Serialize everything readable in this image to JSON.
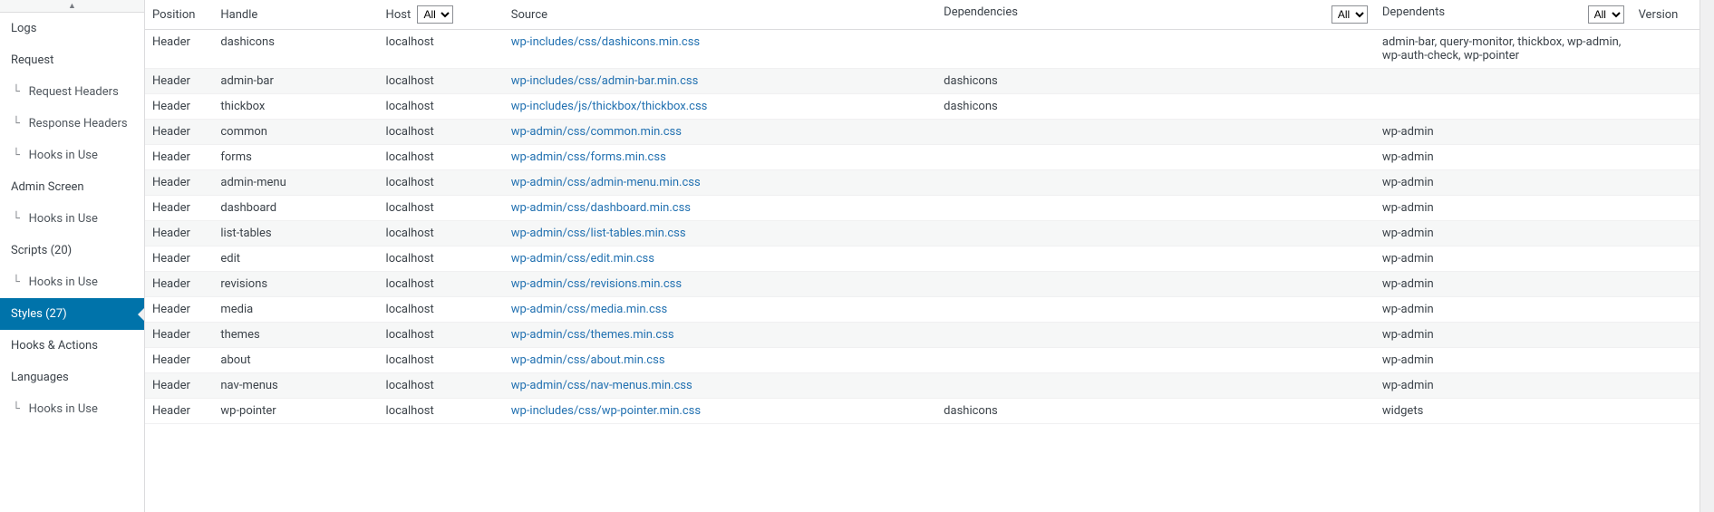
{
  "sidebar": {
    "items": [
      {
        "label": "Logs",
        "sub": false,
        "active": false
      },
      {
        "label": "Request",
        "sub": false,
        "active": false
      },
      {
        "label": "Request Headers",
        "sub": true,
        "active": false
      },
      {
        "label": "Response Headers",
        "sub": true,
        "active": false
      },
      {
        "label": "Hooks in Use",
        "sub": true,
        "active": false
      },
      {
        "label": "Admin Screen",
        "sub": false,
        "active": false
      },
      {
        "label": "Hooks in Use",
        "sub": true,
        "active": false
      },
      {
        "label": "Scripts (20)",
        "sub": false,
        "active": false
      },
      {
        "label": "Hooks in Use",
        "sub": true,
        "active": false
      },
      {
        "label": "Styles (27)",
        "sub": false,
        "active": true
      },
      {
        "label": "Hooks & Actions",
        "sub": false,
        "active": false
      },
      {
        "label": "Languages",
        "sub": false,
        "active": false
      },
      {
        "label": "Hooks in Use",
        "sub": true,
        "active": false
      }
    ]
  },
  "table": {
    "headers": {
      "position": "Position",
      "handle": "Handle",
      "host": "Host",
      "source": "Source",
      "dependencies": "Dependencies",
      "dependents": "Dependents",
      "version": "Version"
    },
    "filters": {
      "host": "All",
      "dependencies": "All",
      "dependents": "All"
    },
    "rows": [
      {
        "position": "Header",
        "handle": "dashicons",
        "host": "localhost",
        "source": "wp-includes/css/dashicons.min.css",
        "dependencies": "",
        "dependents": "admin-bar, query-monitor, thickbox, wp-admin, wp-auth-check, wp-pointer",
        "version": ""
      },
      {
        "position": "Header",
        "handle": "admin-bar",
        "host": "localhost",
        "source": "wp-includes/css/admin-bar.min.css",
        "dependencies": "dashicons",
        "dependents": "",
        "version": ""
      },
      {
        "position": "Header",
        "handle": "thickbox",
        "host": "localhost",
        "source": "wp-includes/js/thickbox/thickbox.css",
        "dependencies": "dashicons",
        "dependents": "",
        "version": ""
      },
      {
        "position": "Header",
        "handle": "common",
        "host": "localhost",
        "source": "wp-admin/css/common.min.css",
        "dependencies": "",
        "dependents": "wp-admin",
        "version": ""
      },
      {
        "position": "Header",
        "handle": "forms",
        "host": "localhost",
        "source": "wp-admin/css/forms.min.css",
        "dependencies": "",
        "dependents": "wp-admin",
        "version": ""
      },
      {
        "position": "Header",
        "handle": "admin-menu",
        "host": "localhost",
        "source": "wp-admin/css/admin-menu.min.css",
        "dependencies": "",
        "dependents": "wp-admin",
        "version": ""
      },
      {
        "position": "Header",
        "handle": "dashboard",
        "host": "localhost",
        "source": "wp-admin/css/dashboard.min.css",
        "dependencies": "",
        "dependents": "wp-admin",
        "version": ""
      },
      {
        "position": "Header",
        "handle": "list-tables",
        "host": "localhost",
        "source": "wp-admin/css/list-tables.min.css",
        "dependencies": "",
        "dependents": "wp-admin",
        "version": ""
      },
      {
        "position": "Header",
        "handle": "edit",
        "host": "localhost",
        "source": "wp-admin/css/edit.min.css",
        "dependencies": "",
        "dependents": "wp-admin",
        "version": ""
      },
      {
        "position": "Header",
        "handle": "revisions",
        "host": "localhost",
        "source": "wp-admin/css/revisions.min.css",
        "dependencies": "",
        "dependents": "wp-admin",
        "version": ""
      },
      {
        "position": "Header",
        "handle": "media",
        "host": "localhost",
        "source": "wp-admin/css/media.min.css",
        "dependencies": "",
        "dependents": "wp-admin",
        "version": ""
      },
      {
        "position": "Header",
        "handle": "themes",
        "host": "localhost",
        "source": "wp-admin/css/themes.min.css",
        "dependencies": "",
        "dependents": "wp-admin",
        "version": ""
      },
      {
        "position": "Header",
        "handle": "about",
        "host": "localhost",
        "source": "wp-admin/css/about.min.css",
        "dependencies": "",
        "dependents": "wp-admin",
        "version": ""
      },
      {
        "position": "Header",
        "handle": "nav-menus",
        "host": "localhost",
        "source": "wp-admin/css/nav-menus.min.css",
        "dependencies": "",
        "dependents": "wp-admin",
        "version": ""
      },
      {
        "position": "Header",
        "handle": "wp-pointer",
        "host": "localhost",
        "source": "wp-includes/css/wp-pointer.min.css",
        "dependencies": "dashicons",
        "dependents": "widgets",
        "version": ""
      }
    ]
  }
}
